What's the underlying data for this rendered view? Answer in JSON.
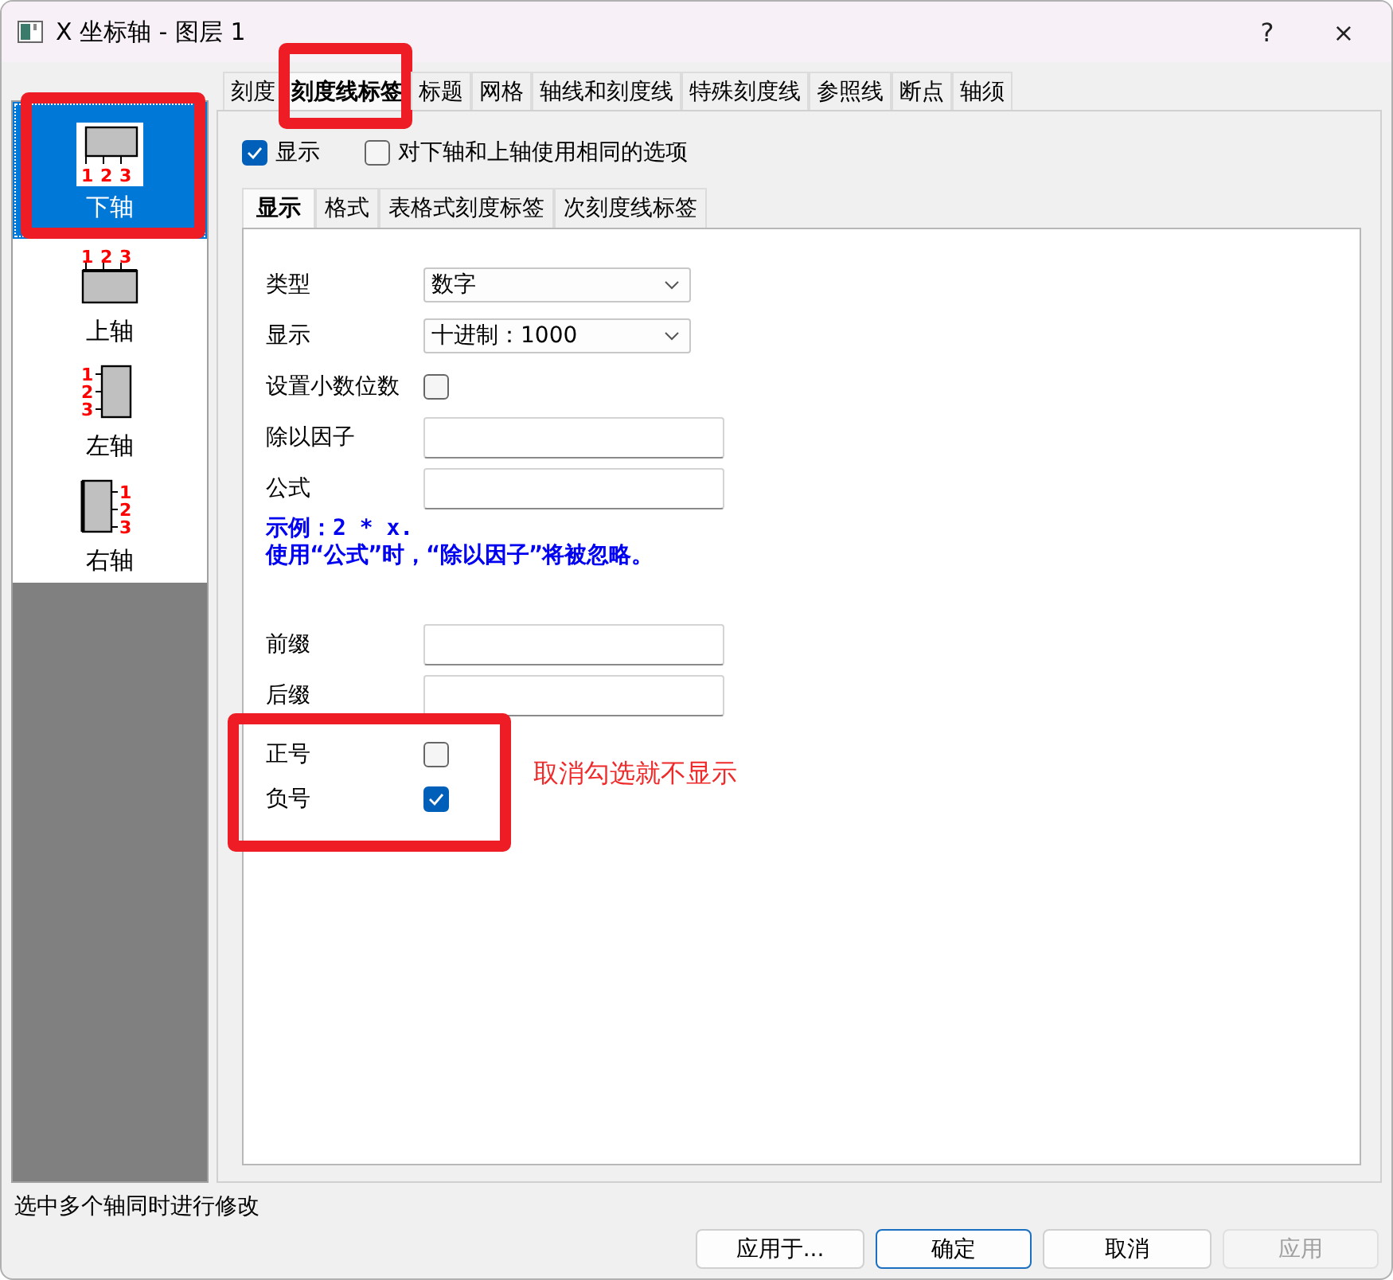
{
  "window": {
    "title": "X 坐标轴 - 图层 1",
    "help": "?",
    "close": "×"
  },
  "sidebar": {
    "items": [
      {
        "label": "下轴",
        "kind": "bottom",
        "tick_labels": [
          "1",
          "2",
          "3"
        ],
        "selected": true,
        "annotated": true
      },
      {
        "label": "上轴",
        "kind": "top",
        "tick_labels": [
          "1",
          "2",
          "3"
        ],
        "selected": false,
        "annotated": false
      },
      {
        "label": "左轴",
        "kind": "left",
        "tick_labels": [
          "1",
          "2",
          "3"
        ],
        "selected": false,
        "annotated": false
      },
      {
        "label": "右轴",
        "kind": "right",
        "tick_labels": [
          "1",
          "2",
          "3"
        ],
        "selected": false,
        "annotated": false
      }
    ]
  },
  "tabs": [
    {
      "label": "刻度",
      "selected": false,
      "annotated": false
    },
    {
      "label": "刻度线标签",
      "selected": true,
      "annotated": true
    },
    {
      "label": "标题",
      "selected": false,
      "annotated": false
    },
    {
      "label": "网格",
      "selected": false,
      "annotated": false
    },
    {
      "label": "轴线和刻度线",
      "selected": false,
      "annotated": false
    },
    {
      "label": "特殊刻度线",
      "selected": false,
      "annotated": false
    },
    {
      "label": "参照线",
      "selected": false,
      "annotated": false
    },
    {
      "label": "断点",
      "selected": false,
      "annotated": false
    },
    {
      "label": "轴须",
      "selected": false,
      "annotated": false
    }
  ],
  "options": [
    {
      "label": "显示",
      "checked": true
    },
    {
      "label": "对下轴和上轴使用相同的选项",
      "checked": false
    }
  ],
  "subtabs": [
    {
      "label": "显示",
      "selected": true
    },
    {
      "label": "格式",
      "selected": false
    },
    {
      "label": "表格式刻度标签",
      "selected": false
    },
    {
      "label": "次刻度线标签",
      "selected": false
    }
  ],
  "form": {
    "rows": [
      {
        "kind": "dropdown",
        "label": "类型",
        "value": "数字"
      },
      {
        "kind": "dropdown",
        "label": "显示",
        "value": "十进制：1000"
      },
      {
        "kind": "checkbox",
        "label": "设置小数位数",
        "checked": false
      },
      {
        "kind": "text",
        "label": "除以因子"
      },
      {
        "kind": "text",
        "label": "公式"
      }
    ],
    "example": [
      "示例：2 * x.",
      "使用“公式”时，“除以因子”将被忽略。"
    ],
    "affix_rows": [
      {
        "kind": "text",
        "label": "前缀"
      },
      {
        "kind": "text",
        "label": "后缀"
      }
    ],
    "sign_options": {
      "annotated": true,
      "note": "取消勾选就不显示",
      "items": [
        {
          "label": "正号",
          "checked": false
        },
        {
          "label": "负号",
          "checked": true
        }
      ]
    }
  },
  "status_bar": "选中多个轴同时进行修改",
  "buttons": [
    {
      "label": "应用于...",
      "kind": "normal"
    },
    {
      "label": "确定",
      "kind": "default"
    },
    {
      "label": "取消",
      "kind": "normal"
    },
    {
      "label": "应用",
      "kind": "disabled"
    }
  ]
}
